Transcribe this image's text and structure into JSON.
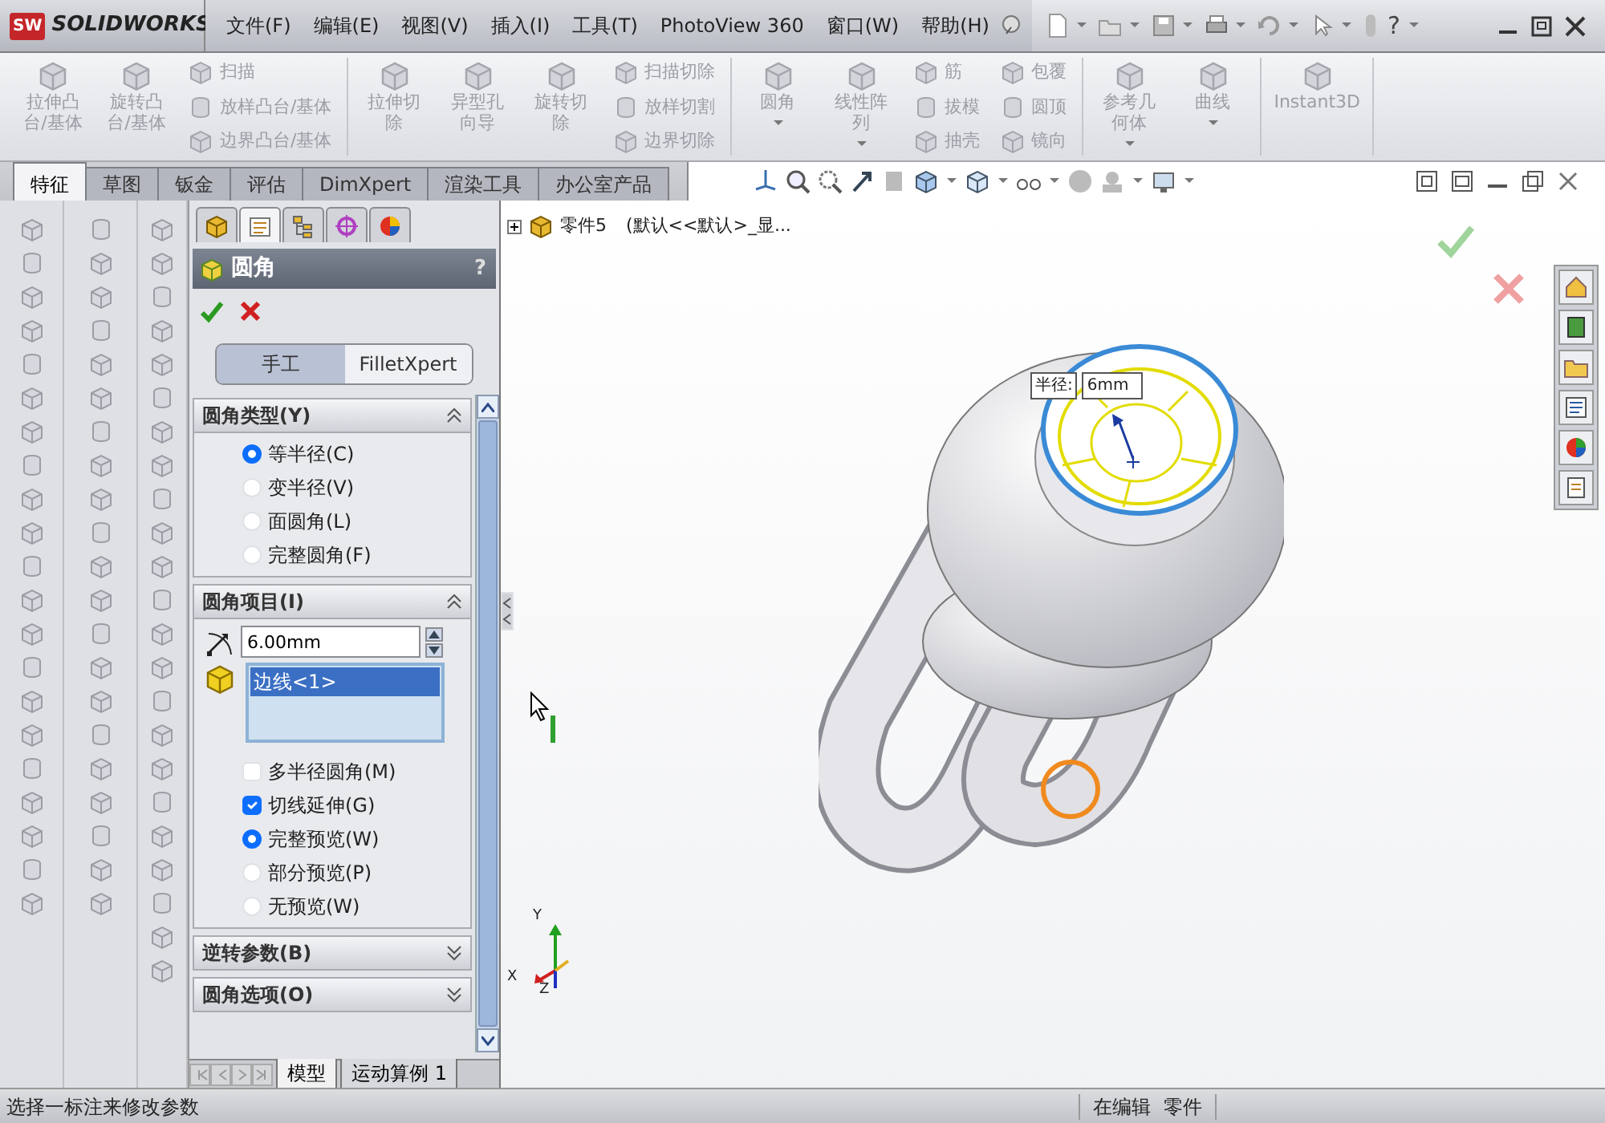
{
  "app": {
    "logo_badge": "SW",
    "logo_text": "SOLIDWORKS"
  },
  "menu": [
    "文件(F)",
    "编辑(E)",
    "视图(V)",
    "插入(I)",
    "工具(T)",
    "PhotoView 360",
    "窗口(W)",
    "帮助(H)"
  ],
  "help_glyph": "?",
  "ribbon": {
    "disabled": true,
    "sections": [
      [
        {
          "kind": "large",
          "items": [
            {
              "lines": [
                "拉伸凸",
                "台/基体"
              ],
              "dropdown": false
            },
            {
              "lines": [
                "旋转凸",
                "台/基体"
              ],
              "dropdown": false
            }
          ]
        },
        {
          "kind": "small",
          "items": [
            {
              "label": "扫描"
            },
            {
              "label": "放样凸台/基体"
            },
            {
              "label": "边界凸台/基体"
            }
          ]
        }
      ],
      [
        {
          "kind": "large",
          "items": [
            {
              "lines": [
                "拉伸切",
                "除"
              ],
              "dropdown": false
            },
            {
              "lines": [
                "异型孔",
                "向导"
              ],
              "dropdown": false
            },
            {
              "lines": [
                "旋转切",
                "除"
              ],
              "dropdown": false
            }
          ]
        },
        {
          "kind": "small",
          "items": [
            {
              "label": "扫描切除"
            },
            {
              "label": "放样切割"
            },
            {
              "label": "边界切除"
            }
          ]
        }
      ],
      [
        {
          "kind": "large",
          "items": [
            {
              "lines": [
                "圆角"
              ],
              "dropdown": true
            },
            {
              "lines": [
                "线性阵",
                "列"
              ],
              "dropdown": true
            }
          ]
        },
        {
          "kind": "small",
          "items": [
            {
              "label": "筋"
            },
            {
              "label": "拔模"
            },
            {
              "label": "抽壳"
            }
          ]
        },
        {
          "kind": "small",
          "items": [
            {
              "label": "包覆"
            },
            {
              "label": "圆顶"
            },
            {
              "label": "镜向"
            }
          ]
        }
      ],
      [
        {
          "kind": "large",
          "items": [
            {
              "lines": [
                "参考几",
                "何体"
              ],
              "dropdown": true
            },
            {
              "lines": [
                "曲线"
              ],
              "dropdown": true
            }
          ]
        }
      ],
      [
        {
          "kind": "large",
          "items": [
            {
              "lines": [
                "Instant3D"
              ],
              "dropdown": false
            }
          ]
        }
      ]
    ]
  },
  "tabs": [
    {
      "label": "特征",
      "selected": true
    },
    {
      "label": "草图",
      "selected": false
    },
    {
      "label": "钣金",
      "selected": false
    },
    {
      "label": "评估",
      "selected": false
    },
    {
      "label": "DimXpert",
      "selected": false
    },
    {
      "label": "渲染工具",
      "selected": false
    },
    {
      "label": "办公室产品",
      "selected": false
    }
  ],
  "property_manager": {
    "tabs": [
      {
        "selected": false
      },
      {
        "selected": true
      },
      {
        "selected": false
      },
      {
        "selected": false
      },
      {
        "selected": false
      }
    ],
    "title": "圆角",
    "help": "?",
    "modes": [
      {
        "label": "手工",
        "selected": true
      },
      {
        "label": "FilletXpert",
        "selected": false
      }
    ],
    "sections": [
      {
        "title": "圆角类型(Y)",
        "expanded": true,
        "items": [
          {
            "kind": "radio",
            "label": "等半径(C)",
            "selected": true
          },
          {
            "kind": "radio",
            "label": "变半径(V)",
            "selected": false
          },
          {
            "kind": "radio",
            "label": "面圆角(L)",
            "selected": false
          },
          {
            "kind": "radio",
            "label": "完整圆角(F)",
            "selected": false
          }
        ]
      },
      {
        "title": "圆角项目(I)",
        "expanded": true,
        "items": [
          {
            "kind": "value",
            "value": "6.00mm"
          },
          {
            "kind": "list",
            "entries": [
              {
                "label": "边线<1>",
                "selected": true
              }
            ]
          },
          {
            "kind": "checkbox",
            "label": "多半径圆角(M)",
            "checked": false
          },
          {
            "kind": "checkbox",
            "label": "切线延伸(G)",
            "checked": true
          },
          {
            "kind": "radio",
            "label": "完整预览(W)",
            "selected": true
          },
          {
            "kind": "radio",
            "label": "部分预览(P)",
            "selected": false
          },
          {
            "kind": "radio",
            "label": "无预览(W)",
            "selected": false
          }
        ]
      },
      {
        "title": "逆转参数(B)",
        "expanded": false
      },
      {
        "title": "圆角选项(O)",
        "expanded": false
      }
    ],
    "bottom_tabs": [
      {
        "label": "模型",
        "selected": true
      },
      {
        "label": "运动算例 1",
        "selected": false
      }
    ]
  },
  "viewport": {
    "tree": {
      "part": "零件5",
      "config": "(默认<<默认>_显..."
    },
    "callout": {
      "label": "半径:",
      "value": "6mm"
    },
    "triad": [
      "Y",
      "X",
      "Z"
    ]
  },
  "status_bar": {
    "message": "选择一标注来修改参数",
    "mode": "在编辑",
    "document": "零件"
  }
}
